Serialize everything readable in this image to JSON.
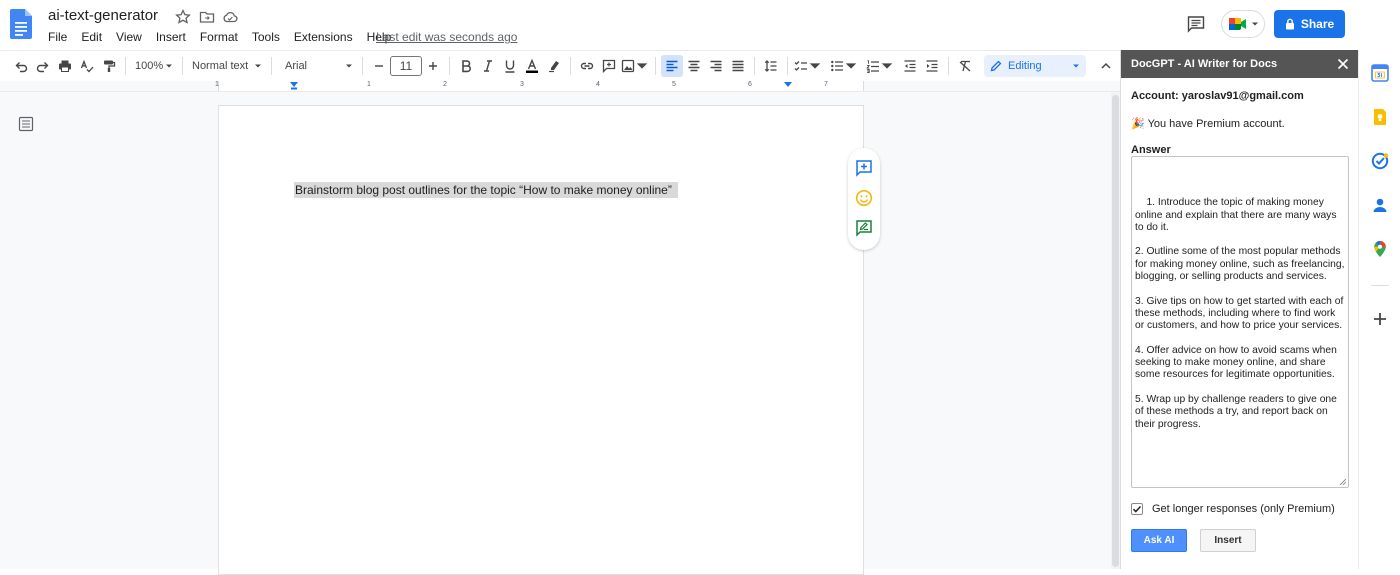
{
  "header": {
    "title": "ai-text-generator",
    "last_edit": "Last edit was seconds ago",
    "share_label": "Share"
  },
  "menu": [
    "File",
    "Edit",
    "View",
    "Insert",
    "Format",
    "Tools",
    "Extensions",
    "Help"
  ],
  "toolbar": {
    "zoom": "100%",
    "style": "Normal text",
    "font": "Arial",
    "font_size": "11",
    "mode": "Editing"
  },
  "ruler": {
    "numbers": [
      "1",
      "1",
      "2",
      "3",
      "4",
      "5",
      "6",
      "7"
    ]
  },
  "document": {
    "text": "Brainstorm blog post outlines for the topic “How to make money online”"
  },
  "panel": {
    "title": "DocGPT - AI Writer for Docs",
    "account": "Account: yaroslav91@gmail.com",
    "premium_emoji": "🎉",
    "premium": "You have Premium account.",
    "answer_label": "Answer",
    "answer_text": "1. Introduce the topic of making money online and explain that there are many ways to do it.\n\n2. Outline some of the most popular methods for making money online, such as freelancing, blogging, or selling products and services.\n\n3. Give tips on how to get started with each of these methods, including where to find work or customers, and how to price your services.\n\n4. Offer advice on how to avoid scams when seeking to make money online, and share some resources for legitimate opportunities.\n\n5. Wrap up by challenge readers to give one of these methods a try, and report back on their progress.",
    "longer_label": "Get longer responses (only Premium)",
    "longer_checked": true,
    "ask_label": "Ask AI",
    "insert_label": "Insert"
  },
  "colors": {
    "accent": "#1a73e8",
    "panel_header": "#555555",
    "ask_button": "#4d90fe",
    "highlight": "#d9d9d9"
  },
  "icons": {
    "rail": [
      "calendar-icon",
      "keep-icon",
      "tasks-icon",
      "contacts-icon",
      "maps-icon",
      "add-icon"
    ]
  }
}
